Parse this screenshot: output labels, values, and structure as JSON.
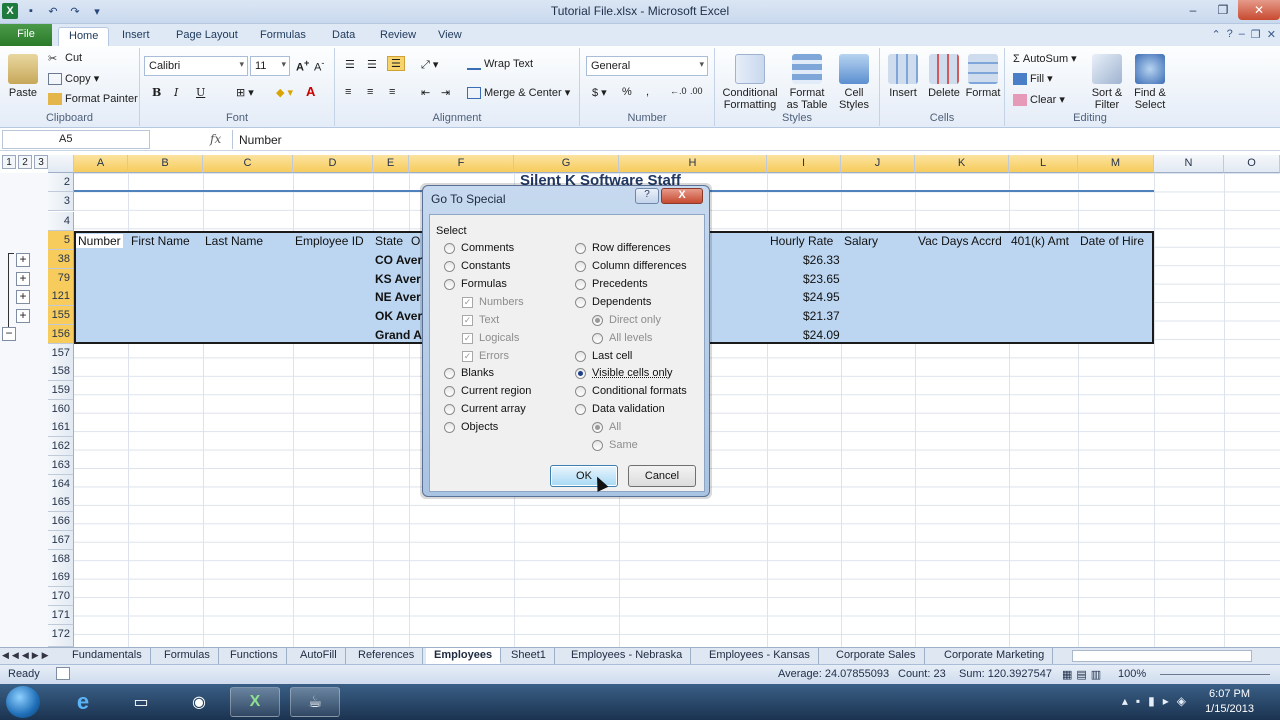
{
  "window": {
    "title": "Tutorial File.xlsx - Microsoft Excel"
  },
  "ribbon_tabs": [
    "File",
    "Home",
    "Insert",
    "Page Layout",
    "Formulas",
    "Data",
    "Review",
    "View"
  ],
  "ribbon": {
    "clipboard": {
      "paste": "Paste",
      "cut": "Cut",
      "copy": "Copy",
      "format_painter": "Format Painter",
      "label": "Clipboard"
    },
    "font": {
      "name": "Calibri",
      "size": "11",
      "label": "Font",
      "bold": "B",
      "italic": "I",
      "underline": "U"
    },
    "alignment": {
      "wrap_text": "Wrap Text",
      "merge_center": "Merge & Center",
      "label": "Alignment"
    },
    "number": {
      "format": "General",
      "currency": "$",
      "percent": "%",
      "comma": ",",
      "label": "Number"
    },
    "styles": {
      "conditional": "Conditional Formatting",
      "format_table": "Format as Table",
      "cell_styles": "Cell Styles",
      "label": "Styles"
    },
    "cells": {
      "insert": "Insert",
      "delete": "Delete",
      "format": "Format",
      "label": "Cells"
    },
    "editing": {
      "autosum": "AutoSum",
      "fill": "Fill",
      "clear": "Clear",
      "sort_filter": "Sort & Filter",
      "find_select": "Find & Select",
      "label": "Editing"
    }
  },
  "formula_bar": {
    "name_box": "A5",
    "fx": "fx",
    "value": "Number"
  },
  "outline_levels": [
    "1",
    "2",
    "3"
  ],
  "columns": [
    "A",
    "B",
    "C",
    "D",
    "E",
    "F",
    "G",
    "H",
    "I",
    "J",
    "K",
    "L",
    "M",
    "N",
    "O"
  ],
  "rows": [
    "2",
    "3",
    "4",
    "5",
    "38",
    "79",
    "121",
    "155",
    "156",
    "157",
    "158",
    "159",
    "160",
    "161",
    "162",
    "163",
    "164",
    "165",
    "166",
    "167",
    "168",
    "169",
    "170",
    "171",
    "172"
  ],
  "sheet": {
    "title": "Silent K Software Staff",
    "headers": {
      "a": "Number",
      "b": "First Name",
      "c": "Last Name",
      "d": "Employee ID",
      "e": "State",
      "f": "O",
      "i": "Hourly Rate",
      "j": "Salary",
      "k": "Vac Days Accrd",
      "l": "401(k) Amt",
      "m": "Date of Hire"
    },
    "subtotal_rows": [
      {
        "label": "CO Aver",
        "rate": "$26.33"
      },
      {
        "label": "KS Aver",
        "rate": "$23.65"
      },
      {
        "label": "NE Aver",
        "rate": "$24.95"
      },
      {
        "label": "OK Aver",
        "rate": "$21.37"
      },
      {
        "label": "Grand A",
        "rate": "$24.09"
      }
    ]
  },
  "dialog": {
    "title": "Go To Special",
    "help": "?",
    "close": "X",
    "select_label": "Select",
    "left_options": {
      "comments": "Comments",
      "constants": "Constants",
      "formulas": "Formulas",
      "numbers": "Numbers",
      "text": "Text",
      "logicals": "Logicals",
      "errors": "Errors",
      "blanks": "Blanks",
      "current_region": "Current region",
      "current_array": "Current array",
      "objects": "Objects"
    },
    "right_options": {
      "row_differences": "Row differences",
      "column_differences": "Column differences",
      "precedents": "Precedents",
      "dependents": "Dependents",
      "direct_only": "Direct only",
      "all_levels": "All levels",
      "last_cell": "Last cell",
      "visible_cells_only": "Visible cells only",
      "conditional_formats": "Conditional formats",
      "data_validation": "Data validation",
      "all": "All",
      "same": "Same"
    },
    "ok": "OK",
    "cancel": "Cancel"
  },
  "sheet_tabs": [
    "Fundamentals",
    "Formulas",
    "Functions",
    "AutoFill",
    "References",
    "Employees",
    "Sheet1",
    "Employees - Nebraska",
    "Employees - Kansas",
    "Corporate Sales",
    "Corporate Marketing"
  ],
  "active_sheet": "Employees",
  "status": {
    "ready": "Ready",
    "average": "Average: 24.07855093",
    "count": "Count: 23",
    "sum": "Sum: 120.3927547",
    "zoom": "100%"
  },
  "taskbar": {
    "time": "6:07 PM",
    "date": "1/15/2013"
  },
  "colors": {
    "selection": "#bcd6f1",
    "header_highlight": "#f7cc5c",
    "excel_green": "#1f7a3e"
  }
}
